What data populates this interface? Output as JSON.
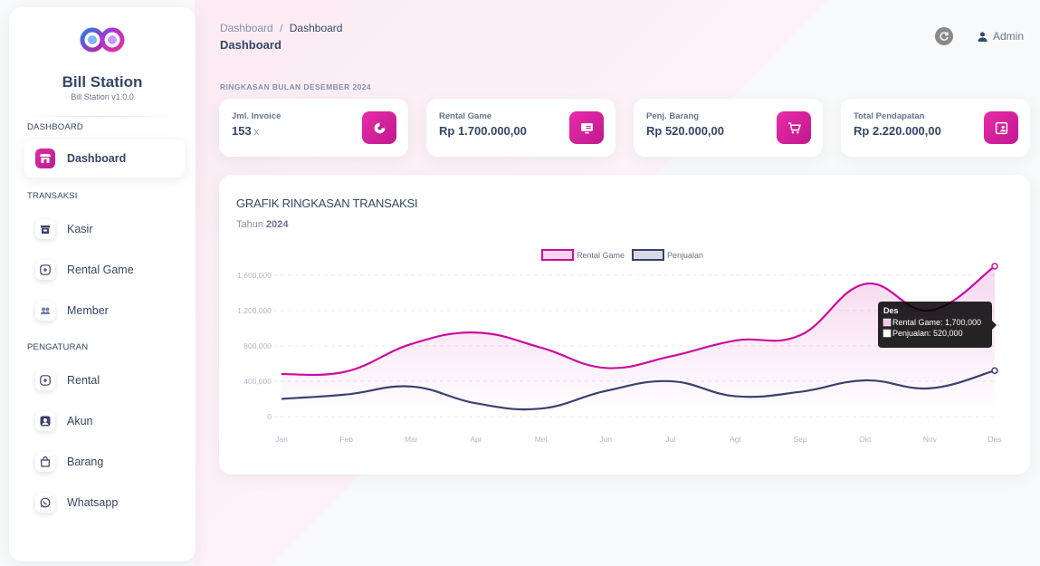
{
  "sidebar": {
    "brand_title": "Bill Station",
    "brand_subtitle": "Bill Station v1.0.0",
    "sections": {
      "dashboard": "DASHBOARD",
      "transaksi": "TRANSAKSI",
      "pengaturan": "PENGATURAN"
    },
    "items": [
      {
        "label": "Dashboard",
        "icon": "store-icon",
        "active": true
      },
      {
        "label": "Kasir",
        "icon": "cashier-icon"
      },
      {
        "label": "Rental Game",
        "icon": "gamepad-icon"
      },
      {
        "label": "Member",
        "icon": "member-icon"
      },
      {
        "label": "Rental",
        "icon": "gamepad-icon"
      },
      {
        "label": "Akun",
        "icon": "user-circle-icon"
      },
      {
        "label": "Barang",
        "icon": "bag-icon"
      },
      {
        "label": "Whatsapp",
        "icon": "whatsapp-icon"
      }
    ]
  },
  "header": {
    "breadcrumb_parent": "Dashboard",
    "breadcrumb_separator": "/",
    "breadcrumb_current": "Dashboard",
    "title": "Dashboard",
    "user_label": "Admin"
  },
  "summary": {
    "label": "RINGKASAN BULAN DESEMBER 2024",
    "cards": [
      {
        "label": "Jml. Invoice",
        "value": "153",
        "unit": "x",
        "icon": "chart-pie-icon"
      },
      {
        "label": "Rental Game",
        "value": "Rp 1.700.000,00",
        "icon": "monitor-icon"
      },
      {
        "label": "Penj. Barang",
        "value": "Rp 520.000,00",
        "icon": "cart-icon"
      },
      {
        "label": "Total Pendapatan",
        "value": "Rp 2.220.000,00",
        "icon": "wallet-icon"
      }
    ]
  },
  "chart": {
    "title": "GRAFIK RINGKASAN TRANSAKSI",
    "subtitle_prefix": "Tahun",
    "subtitle_year": "2024"
  },
  "chart_data": {
    "type": "line",
    "categories": [
      "Jan",
      "Feb",
      "Mar",
      "Apr",
      "Mei",
      "Jun",
      "Jul",
      "Agt",
      "Sep",
      "Okt",
      "Nov",
      "Des"
    ],
    "series": [
      {
        "name": "Rental Game",
        "color": "#cb0c9f",
        "values": [
          480000,
          510000,
          820000,
          950000,
          780000,
          550000,
          680000,
          860000,
          920000,
          1500000,
          1200000,
          1700000
        ]
      },
      {
        "name": "Penjualan",
        "color": "#3a416f",
        "values": [
          200000,
          250000,
          340000,
          150000,
          90000,
          290000,
          400000,
          230000,
          280000,
          410000,
          320000,
          520000
        ]
      }
    ],
    "ylim": [
      0,
      1700000
    ],
    "yticks": [
      "0",
      "400,000",
      "800,000",
      "1,200,000",
      "1,600,000"
    ],
    "ytick_values": [
      0,
      400000,
      800000,
      1200000,
      1600000
    ],
    "grid": true,
    "legend": "top-center",
    "tooltip": {
      "title": "Des",
      "lines": [
        "Rental Game: 1,700,000",
        "Penjualan: 520,000"
      ]
    }
  }
}
